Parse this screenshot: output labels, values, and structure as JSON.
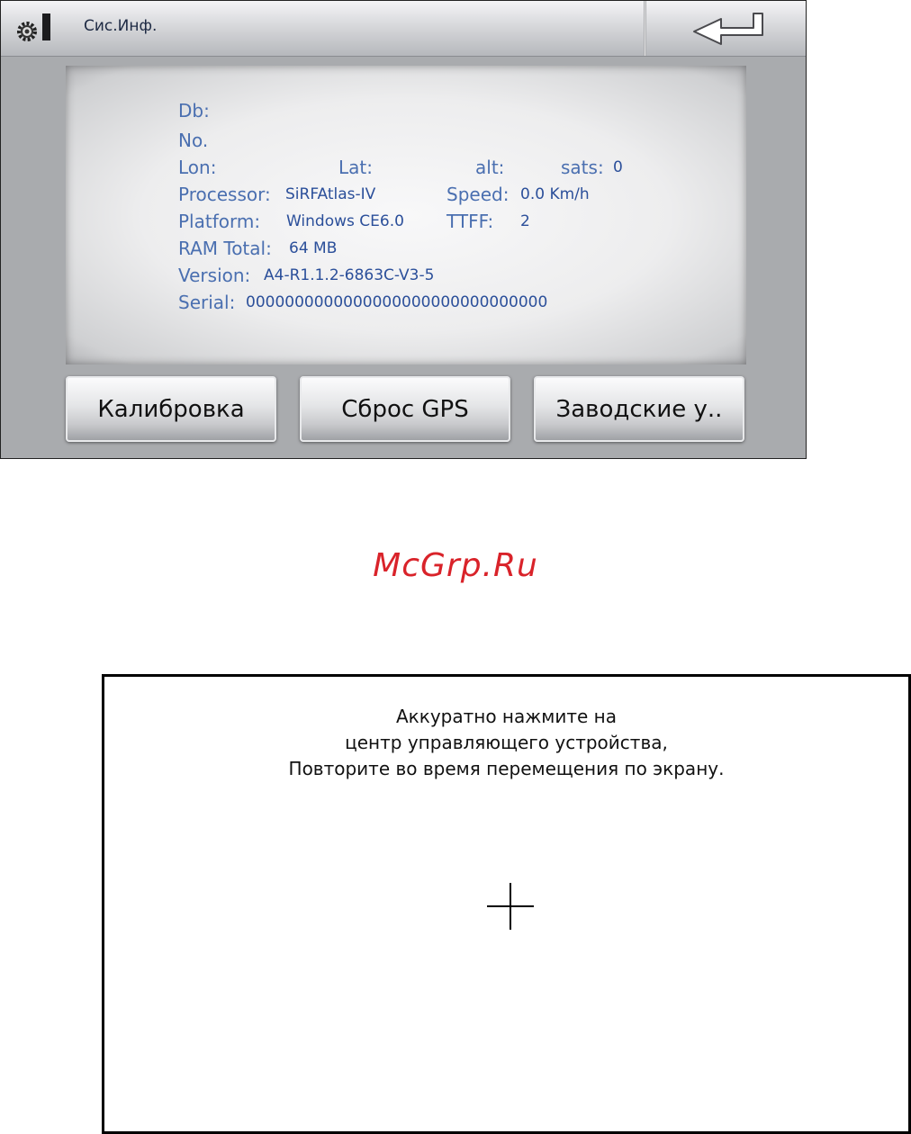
{
  "sysinfo": {
    "title": "Сис.Инф.",
    "icons": {
      "settings": "gear-icon",
      "back": "back-arrow-icon"
    },
    "fields": {
      "db": {
        "label": "Db:"
      },
      "no": {
        "label": "No."
      },
      "lon": {
        "label": "Lon:"
      },
      "lat": {
        "label": "Lat:"
      },
      "alt": {
        "label": "alt:"
      },
      "sats": {
        "label": "sats:",
        "value": "0"
      },
      "processor": {
        "label": "Processor:",
        "value": "SiRFAtlas-IV"
      },
      "speed": {
        "label": "Speed:",
        "value": "0.0 Km/h"
      },
      "platform": {
        "label": "Platform:",
        "value": "Windows CE6.0"
      },
      "ttff": {
        "label": "TTFF:",
        "value": "2"
      },
      "ram": {
        "label": "RAM Total:",
        "value": "64 MB"
      },
      "version": {
        "label": "Version:",
        "value": "A4-R1.1.2-6863C-V3-5"
      },
      "serial": {
        "label": "Serial:",
        "value": "0000000000000000000000000000000"
      }
    },
    "buttons": {
      "calibrate": "Калибровка",
      "reset_gps": "Сброс GPS",
      "factory": "Заводские у.."
    }
  },
  "watermark": "McGrp.Ru",
  "calibration": {
    "line1": "Аккуратно нажмите на",
    "line2": "центр управляющего устройства,",
    "line3": "Повторите во время перемещения по экрану."
  },
  "colors": {
    "label": "#4a6fb0",
    "value": "#2b4f9a",
    "watermark": "#d9232a"
  }
}
